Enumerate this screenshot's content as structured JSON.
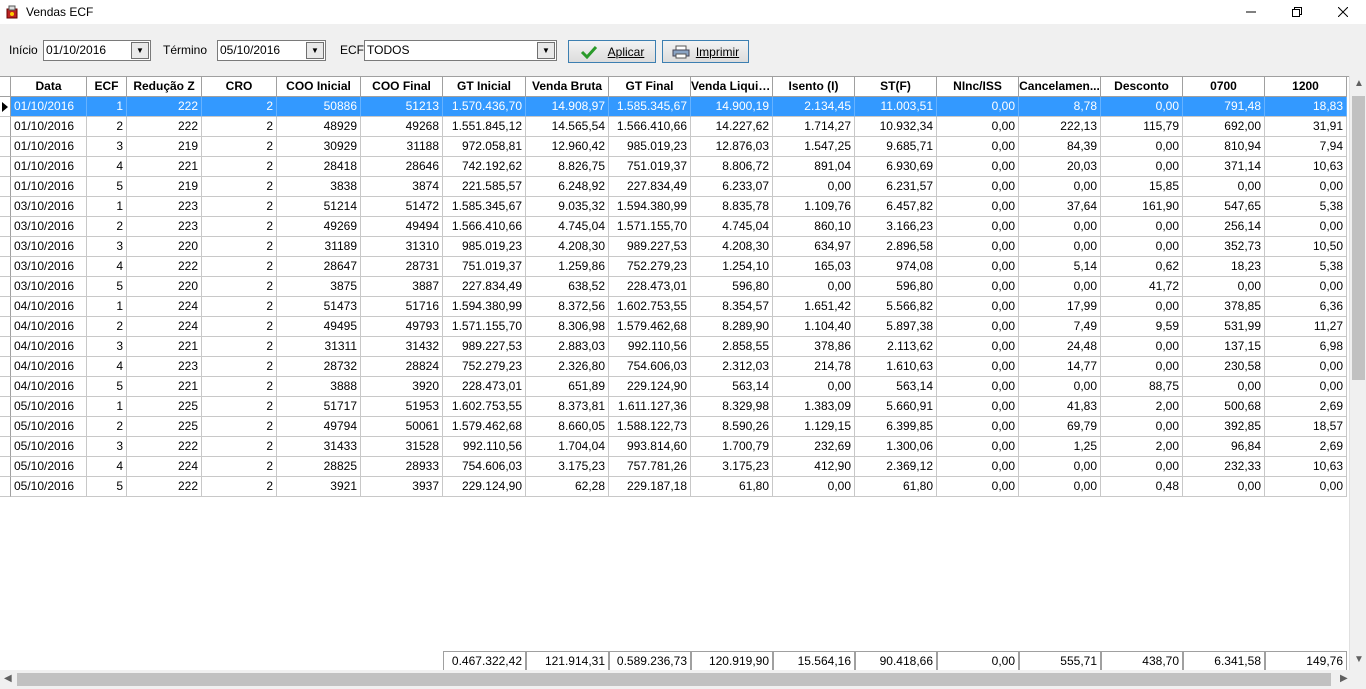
{
  "window": {
    "title": "Vendas ECF"
  },
  "filters": {
    "inicio_label": "Início",
    "inicio_value": "01/10/2016",
    "termino_label": "Término",
    "termino_value": "05/10/2016",
    "ecf_label": "ECF",
    "ecf_value": "TODOS"
  },
  "buttons": {
    "aplicar": "Aplicar",
    "imprimir": "Imprimir"
  },
  "columns": [
    "Data",
    "ECF",
    "Redução Z",
    "CRO",
    "COO Inicial",
    "COO Final",
    "GT Inicial",
    "Venda Bruta",
    "GT Final",
    "Venda Liquida",
    "Isento (I)",
    "ST(F)",
    "NInc/ISS",
    "Cancelamen...",
    "Desconto",
    "0700",
    "1200"
  ],
  "rows": [
    [
      "01/10/2016",
      "1",
      "222",
      "2",
      "50886",
      "51213",
      "1.570.436,70",
      "14.908,97",
      "1.585.345,67",
      "14.900,19",
      "2.134,45",
      "11.003,51",
      "0,00",
      "8,78",
      "0,00",
      "791,48",
      "18,83"
    ],
    [
      "01/10/2016",
      "2",
      "222",
      "2",
      "48929",
      "49268",
      "1.551.845,12",
      "14.565,54",
      "1.566.410,66",
      "14.227,62",
      "1.714,27",
      "10.932,34",
      "0,00",
      "222,13",
      "115,79",
      "692,00",
      "31,91"
    ],
    [
      "01/10/2016",
      "3",
      "219",
      "2",
      "30929",
      "31188",
      "972.058,81",
      "12.960,42",
      "985.019,23",
      "12.876,03",
      "1.547,25",
      "9.685,71",
      "0,00",
      "84,39",
      "0,00",
      "810,94",
      "7,94"
    ],
    [
      "01/10/2016",
      "4",
      "221",
      "2",
      "28418",
      "28646",
      "742.192,62",
      "8.826,75",
      "751.019,37",
      "8.806,72",
      "891,04",
      "6.930,69",
      "0,00",
      "20,03",
      "0,00",
      "371,14",
      "10,63"
    ],
    [
      "01/10/2016",
      "5",
      "219",
      "2",
      "3838",
      "3874",
      "221.585,57",
      "6.248,92",
      "227.834,49",
      "6.233,07",
      "0,00",
      "6.231,57",
      "0,00",
      "0,00",
      "15,85",
      "0,00",
      "0,00"
    ],
    [
      "03/10/2016",
      "1",
      "223",
      "2",
      "51214",
      "51472",
      "1.585.345,67",
      "9.035,32",
      "1.594.380,99",
      "8.835,78",
      "1.109,76",
      "6.457,82",
      "0,00",
      "37,64",
      "161,90",
      "547,65",
      "5,38"
    ],
    [
      "03/10/2016",
      "2",
      "223",
      "2",
      "49269",
      "49494",
      "1.566.410,66",
      "4.745,04",
      "1.571.155,70",
      "4.745,04",
      "860,10",
      "3.166,23",
      "0,00",
      "0,00",
      "0,00",
      "256,14",
      "0,00"
    ],
    [
      "03/10/2016",
      "3",
      "220",
      "2",
      "31189",
      "31310",
      "985.019,23",
      "4.208,30",
      "989.227,53",
      "4.208,30",
      "634,97",
      "2.896,58",
      "0,00",
      "0,00",
      "0,00",
      "352,73",
      "10,50"
    ],
    [
      "03/10/2016",
      "4",
      "222",
      "2",
      "28647",
      "28731",
      "751.019,37",
      "1.259,86",
      "752.279,23",
      "1.254,10",
      "165,03",
      "974,08",
      "0,00",
      "5,14",
      "0,62",
      "18,23",
      "5,38"
    ],
    [
      "03/10/2016",
      "5",
      "220",
      "2",
      "3875",
      "3887",
      "227.834,49",
      "638,52",
      "228.473,01",
      "596,80",
      "0,00",
      "596,80",
      "0,00",
      "0,00",
      "41,72",
      "0,00",
      "0,00"
    ],
    [
      "04/10/2016",
      "1",
      "224",
      "2",
      "51473",
      "51716",
      "1.594.380,99",
      "8.372,56",
      "1.602.753,55",
      "8.354,57",
      "1.651,42",
      "5.566,82",
      "0,00",
      "17,99",
      "0,00",
      "378,85",
      "6,36"
    ],
    [
      "04/10/2016",
      "2",
      "224",
      "2",
      "49495",
      "49793",
      "1.571.155,70",
      "8.306,98",
      "1.579.462,68",
      "8.289,90",
      "1.104,40",
      "5.897,38",
      "0,00",
      "7,49",
      "9,59",
      "531,99",
      "11,27"
    ],
    [
      "04/10/2016",
      "3",
      "221",
      "2",
      "31311",
      "31432",
      "989.227,53",
      "2.883,03",
      "992.110,56",
      "2.858,55",
      "378,86",
      "2.113,62",
      "0,00",
      "24,48",
      "0,00",
      "137,15",
      "6,98"
    ],
    [
      "04/10/2016",
      "4",
      "223",
      "2",
      "28732",
      "28824",
      "752.279,23",
      "2.326,80",
      "754.606,03",
      "2.312,03",
      "214,78",
      "1.610,63",
      "0,00",
      "14,77",
      "0,00",
      "230,58",
      "0,00"
    ],
    [
      "04/10/2016",
      "5",
      "221",
      "2",
      "3888",
      "3920",
      "228.473,01",
      "651,89",
      "229.124,90",
      "563,14",
      "0,00",
      "563,14",
      "0,00",
      "0,00",
      "88,75",
      "0,00",
      "0,00"
    ],
    [
      "05/10/2016",
      "1",
      "225",
      "2",
      "51717",
      "51953",
      "1.602.753,55",
      "8.373,81",
      "1.611.127,36",
      "8.329,98",
      "1.383,09",
      "5.660,91",
      "0,00",
      "41,83",
      "2,00",
      "500,68",
      "2,69"
    ],
    [
      "05/10/2016",
      "2",
      "225",
      "2",
      "49794",
      "50061",
      "1.579.462,68",
      "8.660,05",
      "1.588.122,73",
      "8.590,26",
      "1.129,15",
      "6.399,85",
      "0,00",
      "69,79",
      "0,00",
      "392,85",
      "18,57"
    ],
    [
      "05/10/2016",
      "3",
      "222",
      "2",
      "31433",
      "31528",
      "992.110,56",
      "1.704,04",
      "993.814,60",
      "1.700,79",
      "232,69",
      "1.300,06",
      "0,00",
      "1,25",
      "2,00",
      "96,84",
      "2,69"
    ],
    [
      "05/10/2016",
      "4",
      "224",
      "2",
      "28825",
      "28933",
      "754.606,03",
      "3.175,23",
      "757.781,26",
      "3.175,23",
      "412,90",
      "2.369,12",
      "0,00",
      "0,00",
      "0,00",
      "232,33",
      "10,63"
    ],
    [
      "05/10/2016",
      "5",
      "222",
      "2",
      "3921",
      "3937",
      "229.124,90",
      "62,28",
      "229.187,18",
      "61,80",
      "0,00",
      "61,80",
      "0,00",
      "0,00",
      "0,48",
      "0,00",
      "0,00"
    ]
  ],
  "totals": [
    "",
    "",
    "",
    "",
    "",
    "",
    "0.467.322,42",
    "121.914,31",
    "0.589.236,73",
    "120.919,90",
    "15.564,16",
    "90.418,66",
    "0,00",
    "555,71",
    "438,70",
    "6.341,58",
    "149,76"
  ],
  "selected_row": 0
}
